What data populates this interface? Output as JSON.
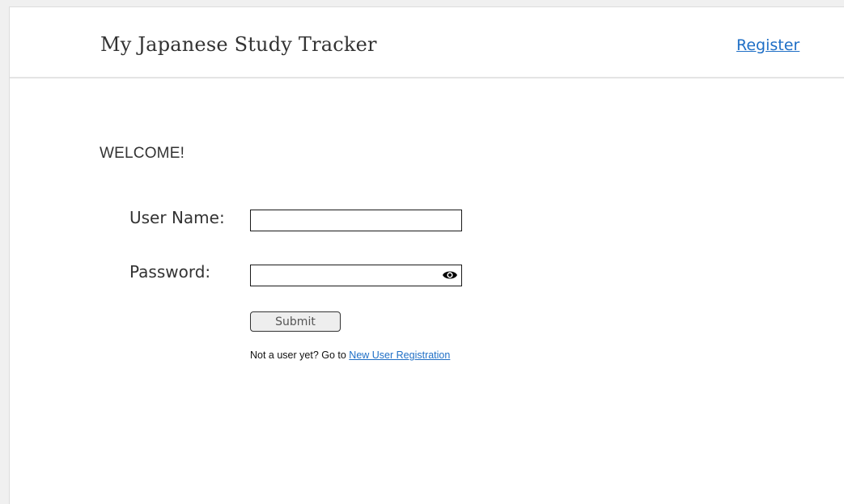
{
  "header": {
    "app_title": "My Japanese Study Tracker",
    "register_link": "Register"
  },
  "login": {
    "welcome": "WELCOME!",
    "username_label": "User Name:",
    "username_value": "",
    "password_label": "Password:",
    "password_value": "",
    "password_toggle_icon": "eye-icon",
    "submit_label": "Submit",
    "footer_prefix": "Not a user yet? Go to ",
    "footer_link": "New User Registration"
  },
  "colors": {
    "link": "#1f6fc6",
    "text": "#333333",
    "button_bg": "#eeeeee"
  }
}
